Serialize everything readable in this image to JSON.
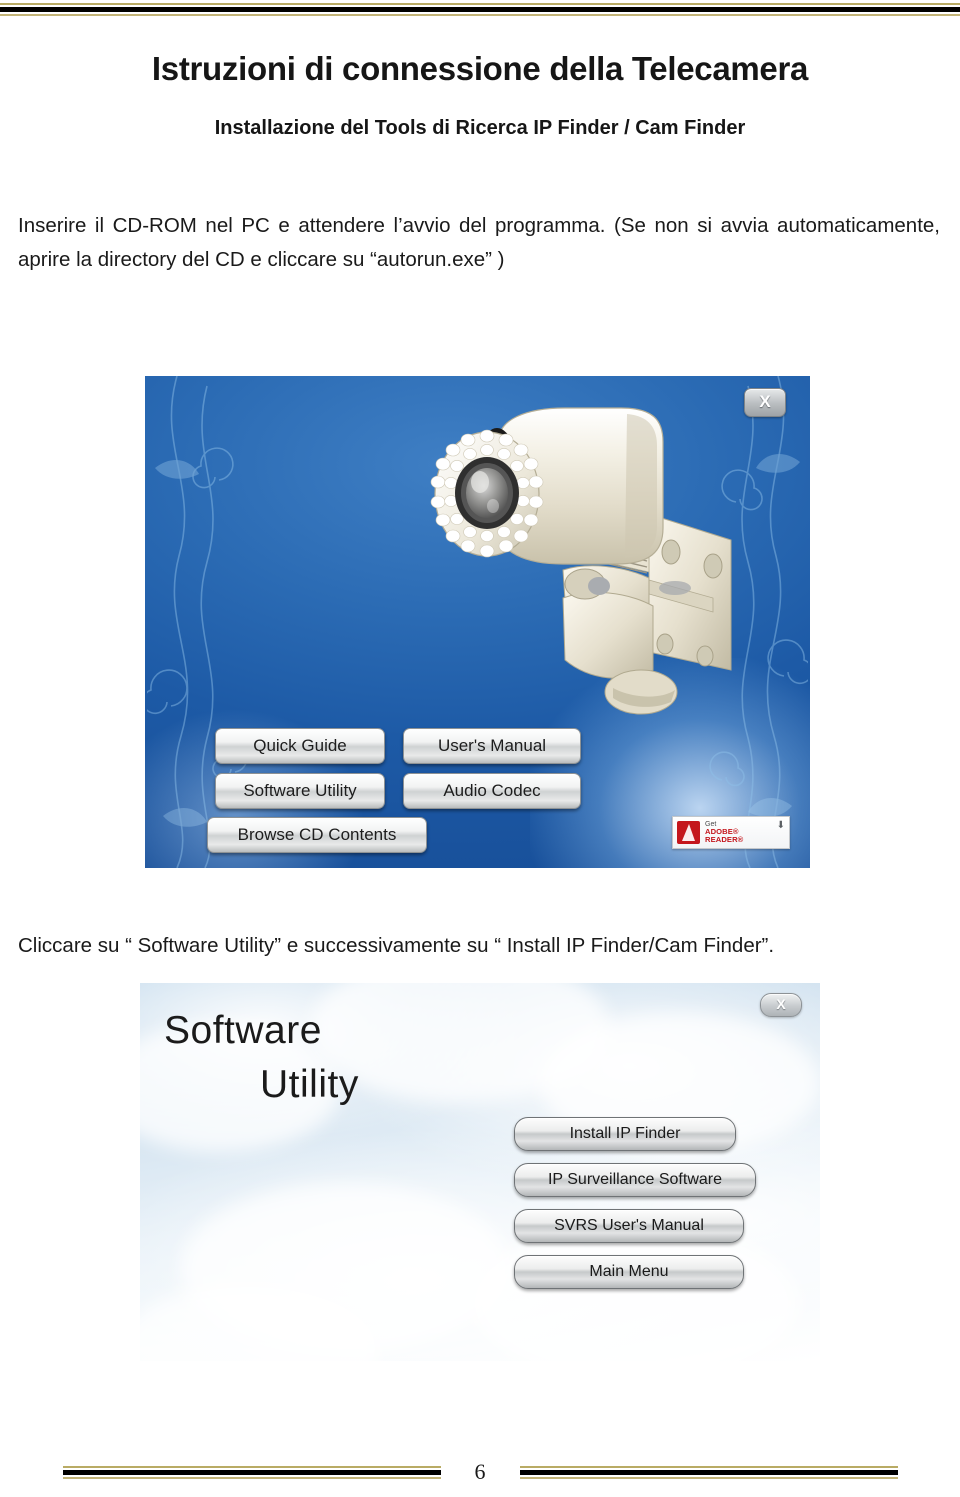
{
  "document": {
    "title": "Istruzioni di connessione della Telecamera",
    "subtitle": "Installazione del Tools di Ricerca IP Finder / Cam Finder",
    "intro_paragraph": "Inserire il CD-ROM nel PC e attendere l’avvio del programma. (Se non si avvia automaticamente, aprire la directory del CD e cliccare su “autorun.exe” )",
    "middle_caption": "Cliccare su “ Software Utility” e successivamente su “ Install IP Finder/Cam Finder”.",
    "page_number": "6"
  },
  "autorun_screenshot": {
    "close_button_label": "X",
    "buttons": [
      {
        "id": "quick-guide",
        "label": "Quick Guide"
      },
      {
        "id": "users-manual",
        "label": "User's Manual"
      },
      {
        "id": "software-utility",
        "label": "Software Utility"
      },
      {
        "id": "audio-codec",
        "label": "Audio Codec"
      },
      {
        "id": "browse-cd-contents",
        "label": "Browse CD Contents"
      }
    ],
    "adobe_badge": {
      "get_label": "Get",
      "reader_label": "ADOBE® READER®",
      "download_icon": "⬇"
    },
    "illustration": "bullet-ip-camera-with-wall-mount"
  },
  "software_utility_screenshot": {
    "title_line1": "Software",
    "title_line2": "Utility",
    "close_button_label": "X",
    "buttons": [
      {
        "id": "install-ip-finder",
        "label": "Install IP Finder"
      },
      {
        "id": "ip-surveillance-software",
        "label": "IP Surveillance Software"
      },
      {
        "id": "svrs-users-manual",
        "label": "SVRS User's Manual"
      },
      {
        "id": "main-menu",
        "label": "Main Menu"
      }
    ]
  },
  "colors": {
    "rule_gold": "#b9ab64",
    "rule_black": "#000000",
    "sky_blue": "#2b6bb4",
    "adobe_red": "#c4161c",
    "camera_body": "#ece7d8",
    "text": "#1a1a1a"
  }
}
